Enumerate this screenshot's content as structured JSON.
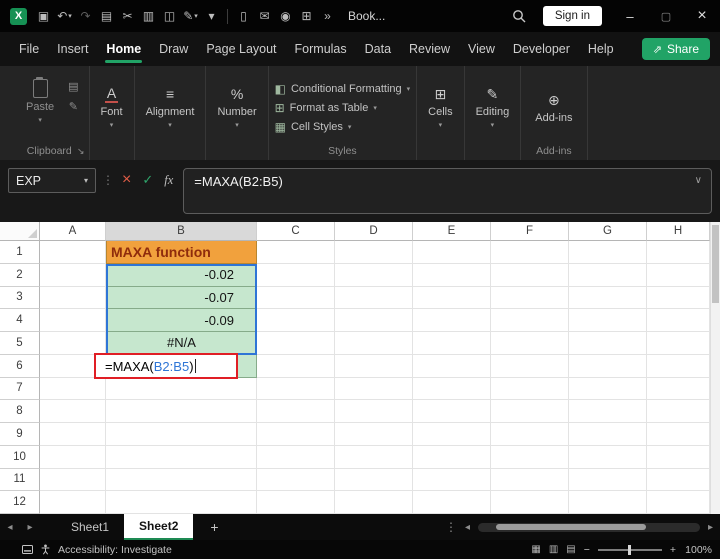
{
  "titlebar": {
    "workbook_name": "Book...",
    "sign_in_label": "Sign in",
    "quick_access": [
      {
        "name": "save-icon",
        "glyph": "▣"
      },
      {
        "name": "undo-icon",
        "glyph": "↶",
        "dropdown": true
      },
      {
        "name": "redo-icon",
        "glyph": "↷",
        "dim": true
      },
      {
        "name": "book-icon",
        "glyph": "▤"
      },
      {
        "name": "cut-icon",
        "glyph": "✂"
      },
      {
        "name": "picture-icon",
        "glyph": "▥"
      },
      {
        "name": "borders-icon",
        "glyph": "◫"
      },
      {
        "name": "format-painter-icon",
        "glyph": "✎",
        "dropdown": true
      },
      {
        "name": "toolbar-overflow-icon",
        "glyph": "▾"
      },
      {
        "divider": true
      },
      {
        "name": "new-document-icon",
        "glyph": "▯"
      },
      {
        "name": "mail-icon",
        "glyph": "✉"
      },
      {
        "name": "camera-icon",
        "glyph": "◉"
      },
      {
        "name": "table-icon",
        "glyph": "⊞"
      },
      {
        "name": "more-commands-icon",
        "glyph": "»"
      }
    ]
  },
  "menubar": {
    "items": [
      "File",
      "Insert",
      "Home",
      "Draw",
      "Page Layout",
      "Formulas",
      "Data",
      "Review",
      "View",
      "Developer",
      "Help"
    ],
    "active": "Home",
    "share_label": "Share"
  },
  "ribbon": {
    "paste_label": "Paste",
    "clipboard_group_label": "Clipboard",
    "font_group": {
      "label": "Font",
      "glyph": "A"
    },
    "alignment_group": {
      "label": "Alignment",
      "glyph": "≡"
    },
    "number_group": {
      "label": "Number",
      "glyph": "%"
    },
    "styles_buttons": [
      {
        "label": "Conditional Formatting",
        "glyph": "◧"
      },
      {
        "label": "Format as Table",
        "glyph": "⊞"
      },
      {
        "label": "Cell Styles",
        "glyph": "▦"
      }
    ],
    "styles_group_label": "Styles",
    "cells_group": {
      "label": "Cells",
      "glyph": "⊞"
    },
    "editing_group": {
      "label": "Editing",
      "glyph": "✎"
    },
    "addins_group": {
      "label": "Add-ins",
      "glyph": "⊕"
    },
    "addins_group_label": "Add-ins"
  },
  "formula_bar": {
    "name_box_value": "EXP",
    "fx_label": "fx",
    "formula": "=MAXA(B2:B5)"
  },
  "grid": {
    "column_headers": [
      "A",
      "B",
      "C",
      "D",
      "E",
      "F",
      "G",
      "H"
    ],
    "row_headers": [
      "1",
      "2",
      "3",
      "4",
      "5",
      "6",
      "7",
      "8",
      "9",
      "10",
      "11",
      "12"
    ],
    "highlighted_column": "B",
    "cells": {
      "B1": "MAXA function",
      "B2": "-0.02",
      "B3": "-0.07",
      "B4": "-0.09",
      "B5": "#N/A"
    },
    "cell_formats": {
      "B1": {
        "bg": "#f1a13d",
        "color": "#8f2c0c",
        "bold": true,
        "align": "left",
        "border": "#b8862f"
      },
      "B2": {
        "bg": "#c6e7ce",
        "align": "right",
        "border": "#86ab8a"
      },
      "B3": {
        "bg": "#c6e7ce",
        "align": "right",
        "border": "#86ab8a"
      },
      "B4": {
        "bg": "#c6e7ce",
        "align": "right",
        "border": "#86ab8a"
      },
      "B5": {
        "bg": "#c6e7ce",
        "align": "center",
        "border": "#86ab8a"
      },
      "B6": {
        "bg": "#c6e7ce",
        "border": "#86ab8a"
      }
    },
    "edit_cell": {
      "address": "B6",
      "prefix": "=MAXA(",
      "reference": "B2:B5",
      "suffix": ")",
      "reference_color": "#2e75d6",
      "highlight_border": "#e01e25"
    },
    "reference_range": "B2:B5"
  },
  "sheetbar": {
    "tabs": [
      "Sheet1",
      "Sheet2"
    ],
    "active": "Sheet2"
  },
  "statusbar": {
    "accessibility_label": "Accessibility: Investigate",
    "zoom_minus": "−",
    "zoom_plus": "+",
    "zoom_level": "100%"
  },
  "colors": {
    "accent_green": "#21a366",
    "header_orange": "#f1a13d",
    "cell_green": "#c6e7ce",
    "reference_blue": "#2e75d6",
    "annotation_red": "#e01e25"
  }
}
